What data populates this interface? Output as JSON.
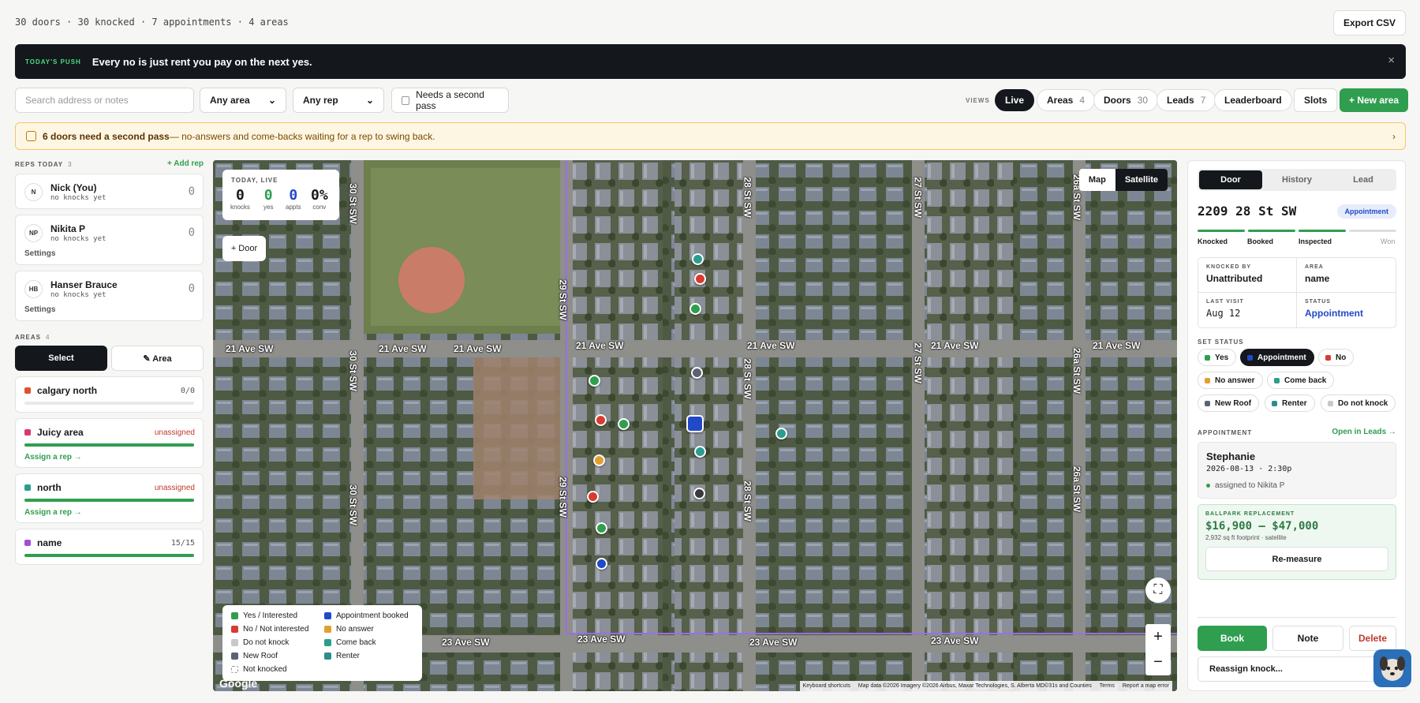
{
  "summary": "30 doors · 30 knocked · 7 appointments · 4 areas",
  "export_label": "Export CSV",
  "push": {
    "tag": "TODAY'S PUSH",
    "message": "Every no is just rent you pay on the next yes.",
    "close": "×"
  },
  "filters": {
    "search_placeholder": "Search address or notes",
    "area": "Any area",
    "rep": "Any rep",
    "second_pass": "Needs a second pass"
  },
  "views": {
    "label": "VIEWS",
    "live": "Live",
    "areas": {
      "label": "Areas",
      "count": "4"
    },
    "doors": {
      "label": "Doors",
      "count": "30"
    },
    "leads": {
      "label": "Leads",
      "count": "7"
    },
    "leaderboard": "Leaderboard"
  },
  "slots_label": "Slots",
  "new_area_label": "+ New area",
  "notice": {
    "bold": "6 doors need a second pass",
    "rest": " — no-answers and come-backs waiting for a rep to swing back.",
    "chevron": "›"
  },
  "reps": {
    "label": "REPS TODAY",
    "count": "3",
    "add": "+ Add rep",
    "items": [
      {
        "initials": "N",
        "name": "Nick (You)",
        "sub": "no knocks yet",
        "count": "0"
      },
      {
        "initials": "NP",
        "name": "Nikita P",
        "sub": "no knocks yet",
        "count": "0",
        "settings": "Settings"
      },
      {
        "initials": "HB",
        "name": "Hanser Brauce",
        "sub": "no knocks yet",
        "count": "0",
        "settings": "Settings"
      }
    ]
  },
  "areas": {
    "label": "AREAS",
    "count": "4",
    "select": "Select",
    "area_btn": "✎ Area",
    "items": [
      {
        "name": "calgary north",
        "right": "0/0",
        "color": "#e0502f",
        "progress": 0
      },
      {
        "name": "Juicy area",
        "right": "unassigned",
        "color": "#d63b6e",
        "progress": 1,
        "assign": "Assign a rep →"
      },
      {
        "name": "north",
        "right": "unassigned",
        "color": "#2a9d8f",
        "progress": 1,
        "assign": "Assign a rep →"
      },
      {
        "name": "name",
        "right": "15/15",
        "color": "#a24fd6",
        "progress": 1
      }
    ]
  },
  "map": {
    "live": {
      "title": "TODAY, LIVE",
      "stats": [
        {
          "value": "0",
          "label": "knocks",
          "color": "#1a1a1a"
        },
        {
          "value": "0",
          "label": "yes",
          "color": "#2f9e4f"
        },
        {
          "value": "0",
          "label": "appts",
          "color": "#2249c7"
        },
        {
          "value": "0%",
          "label": "conv",
          "color": "#1a1a1a"
        }
      ]
    },
    "add_door": "+ Door",
    "types": {
      "map": "Map",
      "satellite": "Satellite"
    },
    "zoom_in": "+",
    "zoom_out": "−",
    "fullscreen": "⛶",
    "streets": {
      "ave21": "21 Ave SW",
      "ave23": "23 Ave SW",
      "st30": "30 St SW",
      "st29": "29 St SW",
      "st28": "28 St SW",
      "st27": "27 St SW",
      "st26a": "26a St SW"
    },
    "legend": [
      {
        "label": "Yes / Interested",
        "color": "#2f9e4f"
      },
      {
        "label": "Appointment booked",
        "color": "#2249c7"
      },
      {
        "label": "No / Not interested",
        "color": "#d93a32"
      },
      {
        "label": "No answer",
        "color": "#e0a030"
      },
      {
        "label": "Do not knock",
        "color": "#c8c8c8"
      },
      {
        "label": "Come back",
        "color": "#2a9d8f"
      },
      {
        "label": "New Roof",
        "color": "#5a6275"
      },
      {
        "label": "Renter",
        "color": "#2a8f8a"
      },
      {
        "label": "Not knocked",
        "color": "#ffffff"
      }
    ],
    "google": "Google",
    "attribution": [
      "Keyboard shortcuts",
      "Map data ©2026 Imagery ©2026 Airbus, Maxar Technologies, S. Alberta MD©31s and Counties",
      "Terms",
      "Report a map error"
    ]
  },
  "door": {
    "tabs": {
      "door": "Door",
      "history": "History",
      "lead": "Lead"
    },
    "address": "2209 28 St SW",
    "badge": "Appointment",
    "stages": [
      "Knocked",
      "Booked",
      "Inspected",
      "Won"
    ],
    "info": {
      "knocked_by_k": "KNOCKED BY",
      "knocked_by": "Unattributed",
      "area_k": "AREA",
      "area": "name",
      "last_visit_k": "LAST VISIT",
      "last_visit": "Aug 12",
      "status_k": "STATUS",
      "status": "Appointment"
    },
    "set_status_label": "SET STATUS",
    "statuses": [
      {
        "label": "Yes",
        "color": "#2f9e4f"
      },
      {
        "label": "Appointment",
        "color": "#2249c7"
      },
      {
        "label": "No",
        "color": "#d93a32"
      },
      {
        "label": "No answer",
        "color": "#e0a030"
      },
      {
        "label": "Come back",
        "color": "#2a9d8f"
      },
      {
        "label": "New Roof",
        "color": "#5a6275"
      },
      {
        "label": "Renter",
        "color": "#2a8f8a"
      },
      {
        "label": "Do not knock",
        "color": "#c8c8c8"
      }
    ],
    "appointment_label": "APPOINTMENT",
    "open_leads": "Open in Leads →",
    "appt": {
      "name": "Stephanie",
      "when": "2026-08-13 · 2:30p",
      "assigned": "assigned to Nikita P"
    },
    "estimate": {
      "label": "BALLPARK REPLACEMENT",
      "range": "$16,900 – $47,000",
      "sub": "2,932 sq ft footprint · satellite",
      "remeasure": "Re-measure"
    },
    "book": "Book",
    "note": "Note",
    "delete": "Delete",
    "reassign": "Reassign knock..."
  }
}
